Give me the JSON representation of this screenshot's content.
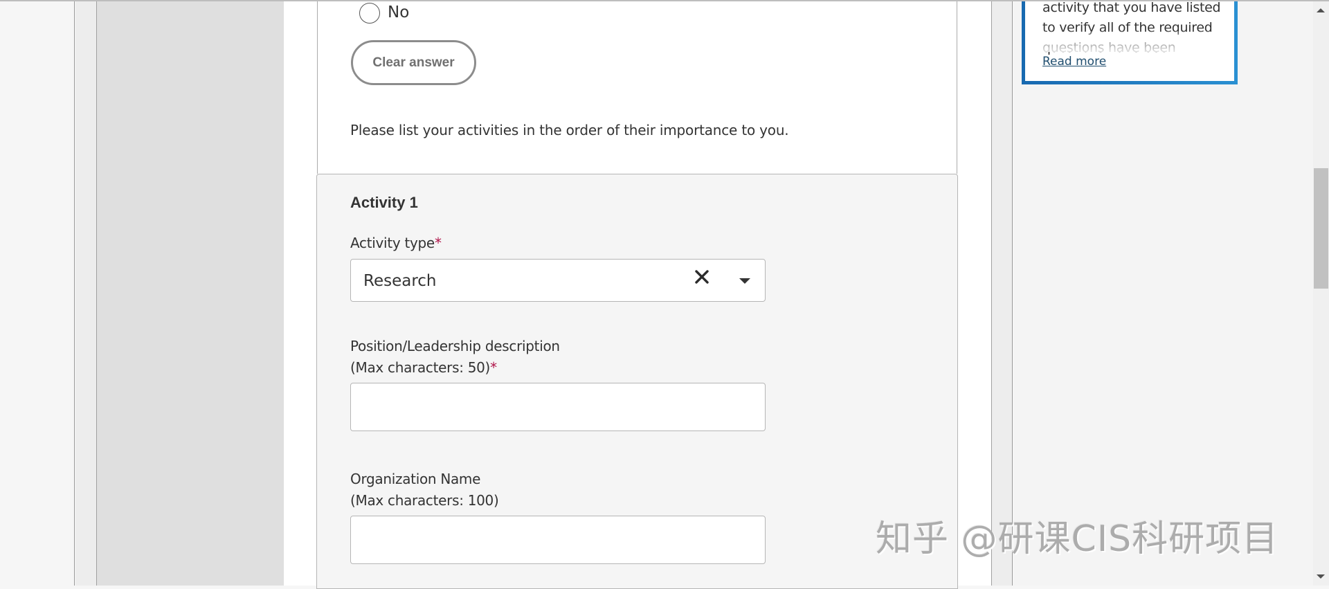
{
  "question": {
    "radio_option_label": "No",
    "radio_option_selected": false,
    "clear_answer_label": "Clear answer",
    "instruction": "Please list your activities in the order of their importance to you."
  },
  "activity": {
    "title": "Activity 1",
    "type_field": {
      "label": "Activity type",
      "required_mark": "*",
      "selected_value": "Research",
      "clear_icon": "close-icon",
      "dropdown_icon": "caret-down-icon"
    },
    "position_field": {
      "label_line1": "Position/Leadership description",
      "label_line2": "(Max characters: 50)",
      "required_mark": "*",
      "value": "",
      "max_characters": 50
    },
    "organization_field": {
      "label_line1": "Organization Name",
      "label_line2": "(Max characters: 100)",
      "value": "",
      "max_characters": 100
    }
  },
  "notice": {
    "text": "activity that you have listed to verify all of the required questions have been",
    "read_more_label": "Read more",
    "border_color": "#1f7cc2"
  },
  "watermark": {
    "text": "知乎 @研课CIS科研项目"
  },
  "colors": {
    "required": "#b0154a",
    "link": "#1f4d6e"
  }
}
